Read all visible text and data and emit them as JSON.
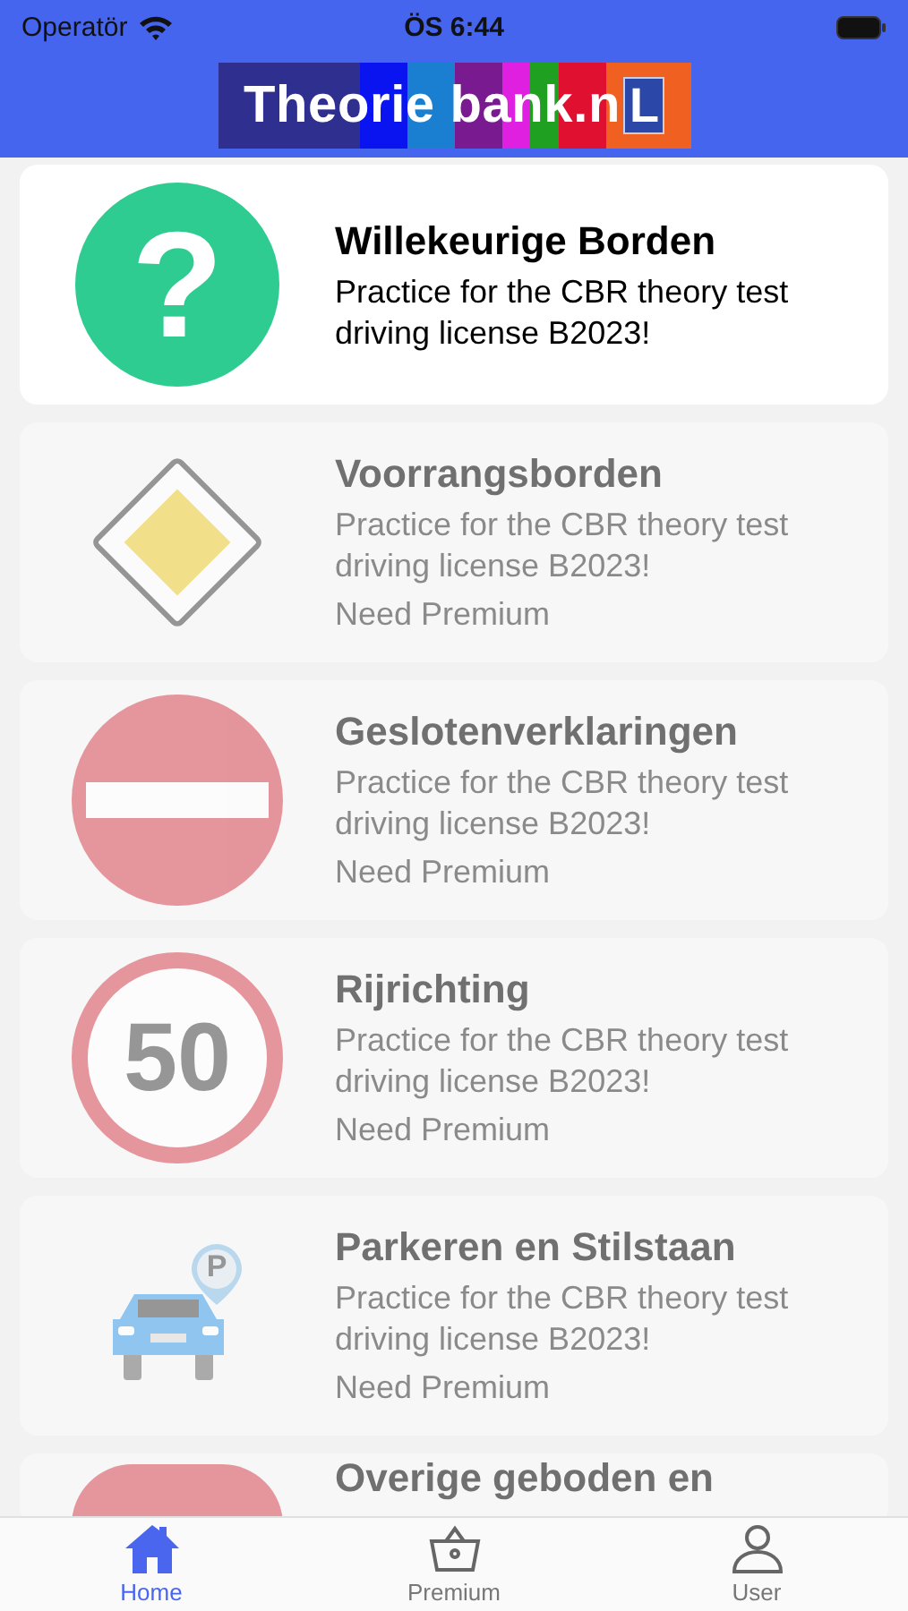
{
  "status_bar": {
    "carrier": "Operatör",
    "time": "ÖS 6:44"
  },
  "logo": {
    "text": "Theorie bank.n",
    "badge": "L"
  },
  "categories": [
    {
      "kind": "question",
      "glyph": "?",
      "title": "Willekeurige Borden",
      "description": "Practice for the CBR theory test driving license B2023!",
      "locked": false
    },
    {
      "kind": "priority",
      "title": "Voorrangsborden",
      "description": "Practice for the CBR theory test driving license B2023!",
      "locked": true,
      "note": "Need Premium"
    },
    {
      "kind": "no-entry",
      "title": "Geslotenverklaringen",
      "description": "Practice for the CBR theory test driving license B2023!",
      "locked": true,
      "note": "Need Premium"
    },
    {
      "kind": "speed",
      "glyph": "50",
      "title": "Rijrichting",
      "description": "Practice for the CBR theory test driving license B2023!",
      "locked": true,
      "note": "Need Premium"
    },
    {
      "kind": "parking",
      "glyph": "P",
      "title": "Parkeren en Stilstaan",
      "description": "Practice for the CBR theory test driving license B2023!",
      "locked": true,
      "note": "Need Premium"
    },
    {
      "kind": "partial",
      "title": "Overige geboden en",
      "locked": true
    }
  ],
  "tabs": [
    {
      "kind": "home",
      "label": "Home",
      "selected": true
    },
    {
      "kind": "basket",
      "label": "Premium",
      "selected": false
    },
    {
      "kind": "user",
      "label": "User",
      "selected": false
    }
  ]
}
